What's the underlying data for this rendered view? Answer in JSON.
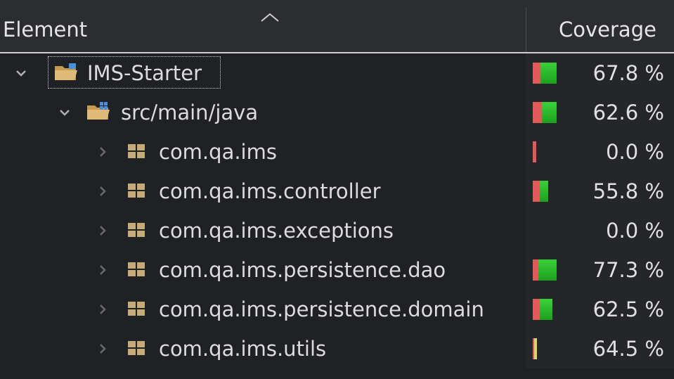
{
  "header": {
    "element_label": "Element",
    "coverage_label": "Coverage"
  },
  "rows": [
    {
      "label": "IMS-Starter",
      "coverage": "67.8 %",
      "coverage_ratio": 0.678,
      "kind": "project",
      "expanded": true
    },
    {
      "label": "src/main/java",
      "coverage": "62.6 %",
      "coverage_ratio": 0.626,
      "kind": "source-folder",
      "expanded": true
    },
    {
      "label": "com.qa.ims",
      "coverage": "0.0 %",
      "coverage_ratio": 0.0,
      "kind": "package",
      "expanded": false
    },
    {
      "label": "com.qa.ims.controller",
      "coverage": "55.8 %",
      "coverage_ratio": 0.558,
      "kind": "package",
      "expanded": false
    },
    {
      "label": "com.qa.ims.exceptions",
      "coverage": "0.0 %",
      "coverage_ratio": 0.0,
      "kind": "package",
      "expanded": false
    },
    {
      "label": "com.qa.ims.persistence.dao",
      "coverage": "77.3 %",
      "coverage_ratio": 0.773,
      "kind": "package",
      "expanded": false
    },
    {
      "label": "com.qa.ims.persistence.domain",
      "coverage": "62.5 %",
      "coverage_ratio": 0.625,
      "kind": "package",
      "expanded": false
    },
    {
      "label": "com.qa.ims.utils",
      "coverage": "64.5 %",
      "coverage_ratio": 0.645,
      "kind": "package",
      "expanded": false
    }
  ],
  "colors": {
    "covered": "#2ec42e",
    "missed": "#e05a5a",
    "folder": "#d9b77a",
    "package": "#c8a978"
  },
  "icons": {
    "expanded": "chevron-down-icon",
    "collapsed": "chevron-right-icon",
    "project": "project-folder-icon",
    "source_folder": "source-folder-icon",
    "package": "package-icon",
    "sort": "sort-ascending-icon"
  }
}
